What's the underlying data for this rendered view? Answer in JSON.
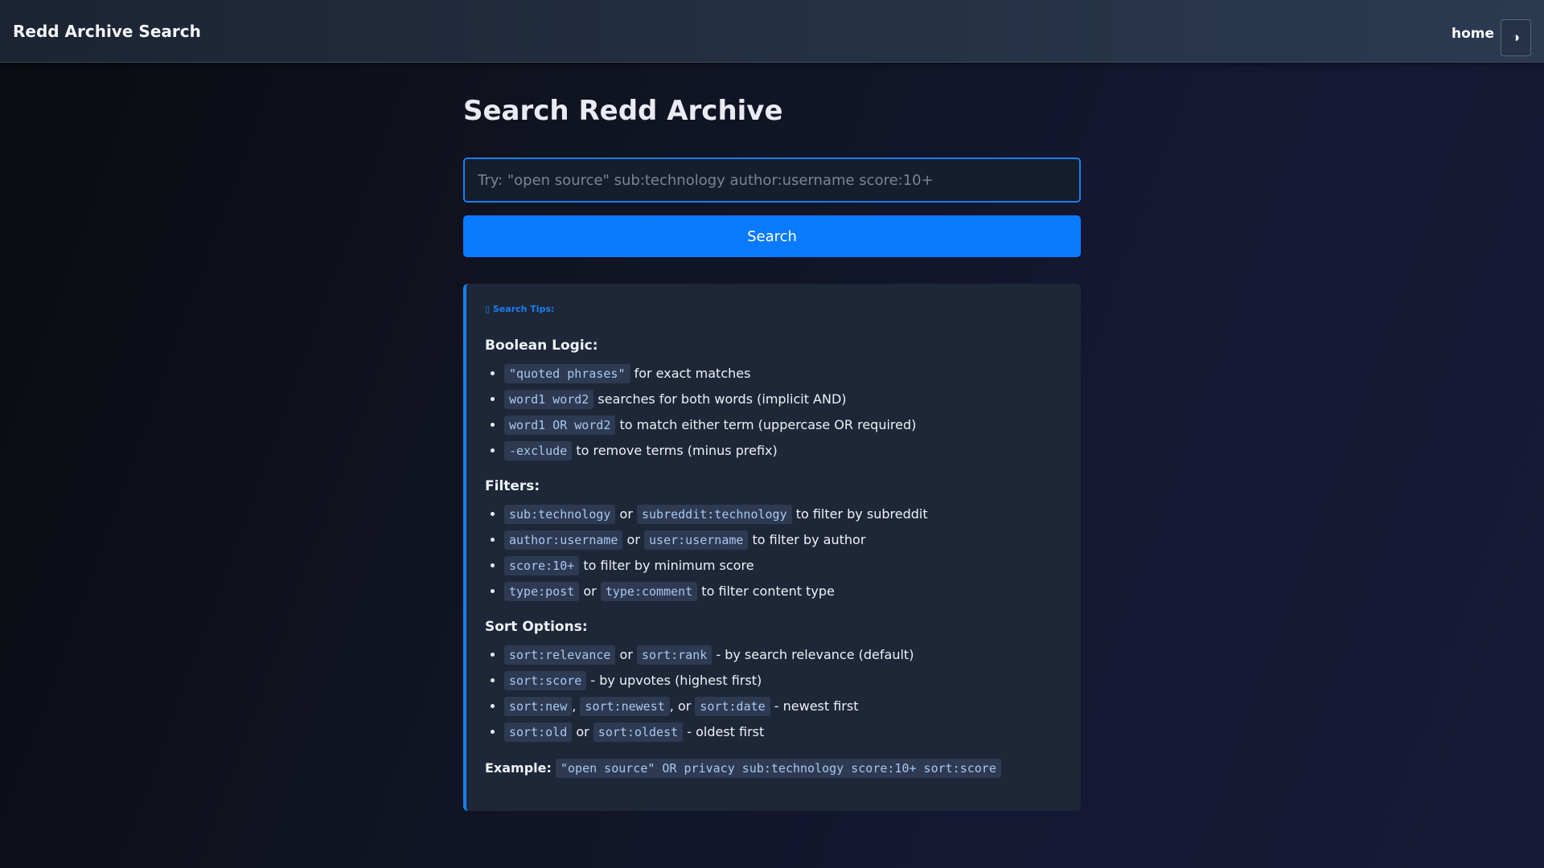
{
  "header": {
    "brand": "Redd Archive Search",
    "home_link": "home",
    "theme_toggle_glyph": "◑",
    "theme_toggle_icon": "contrast-icon"
  },
  "main": {
    "title": "Search Redd Archive",
    "search_placeholder": "Try: \"open source\" sub:technology author:username score:10+",
    "search_value": "",
    "search_button": "Search"
  },
  "tips": {
    "heading": "▯ Search Tips:",
    "boolean": {
      "title": "Boolean Logic:",
      "items": [
        {
          "codes": [
            "\"quoted phrases\""
          ],
          "texts": [
            " for exact matches"
          ]
        },
        {
          "codes": [
            "word1 word2"
          ],
          "texts": [
            " searches for both words (implicit AND)"
          ]
        },
        {
          "codes": [
            "word1 OR word2"
          ],
          "texts": [
            " to match either term (uppercase OR required)"
          ]
        },
        {
          "codes": [
            "-exclude"
          ],
          "texts": [
            " to remove terms (minus prefix)"
          ]
        }
      ]
    },
    "filters": {
      "title": "Filters:",
      "items": [
        {
          "codes": [
            "sub:technology",
            "subreddit:technology"
          ],
          "texts": [
            " or ",
            " to filter by subreddit"
          ]
        },
        {
          "codes": [
            "author:username",
            "user:username"
          ],
          "texts": [
            " or ",
            " to filter by author"
          ]
        },
        {
          "codes": [
            "score:10+"
          ],
          "texts": [
            " to filter by minimum score"
          ]
        },
        {
          "codes": [
            "type:post",
            "type:comment"
          ],
          "texts": [
            " or ",
            " to filter content type"
          ]
        }
      ]
    },
    "sort": {
      "title": "Sort Options:",
      "items": [
        {
          "codes": [
            "sort:relevance",
            "sort:rank"
          ],
          "texts": [
            " or ",
            " - by search relevance (default)"
          ]
        },
        {
          "codes": [
            "sort:score"
          ],
          "texts": [
            " - by upvotes (highest first)"
          ]
        },
        {
          "codes": [
            "sort:new",
            "sort:newest",
            "sort:date"
          ],
          "texts": [
            ", ",
            ", or ",
            " - newest first"
          ]
        },
        {
          "codes": [
            "sort:old",
            "sort:oldest"
          ],
          "texts": [
            " or ",
            " - oldest first"
          ]
        }
      ]
    },
    "example": {
      "label": "Example:",
      "code": "\"open source\" OR privacy sub:technology score:10+ sort:score"
    }
  },
  "colors": {
    "accent": "#0a7bff",
    "code_text": "#a9c7f0",
    "code_bg": "#2d3a52",
    "panel_bg": "#1e2738"
  }
}
